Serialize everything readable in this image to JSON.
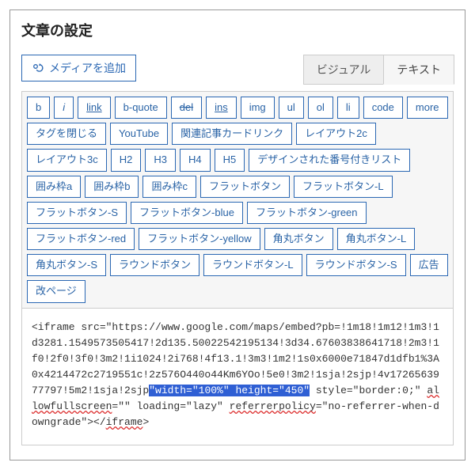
{
  "panel": {
    "title": "文章の設定"
  },
  "media_button": {
    "label": "メディアを追加"
  },
  "tabs": {
    "visual": "ビジュアル",
    "text": "テキスト",
    "active": "text"
  },
  "qt": {
    "b": "b",
    "i": "i",
    "link": "link",
    "bquote": "b-quote",
    "del": "del",
    "ins": "ins",
    "img": "img",
    "ul": "ul",
    "ol": "ol",
    "li": "li",
    "code": "code",
    "more": "more",
    "close": "タグを閉じる",
    "youtube": "YouTube",
    "relcard": "関連記事カードリンク",
    "layout2c": "レイアウト2c",
    "layout3c": "レイアウト3c",
    "h2": "H2",
    "h3": "H3",
    "h4": "H4",
    "h5": "H5",
    "designlist": "デザインされた番号付きリスト",
    "box_a": "囲み枠a",
    "box_b": "囲み枠b",
    "box_c": "囲み枠c",
    "flat": "フラットボタン",
    "flat_l": "フラットボタン-L",
    "flat_s": "フラットボタン-S",
    "flat_blue": "フラットボタン-blue",
    "flat_green": "フラットボタン-green",
    "flat_red": "フラットボタン-red",
    "flat_yellow": "フラットボタン-yellow",
    "round": "角丸ボタン",
    "round_l": "角丸ボタン-L",
    "round_s": "角丸ボタン-S",
    "rbtn": "ラウンドボタン",
    "rbtn_l": "ラウンドボタン-L",
    "rbtn_s": "ラウンドボタン-S",
    "ad": "広告",
    "pagebreak": "改ページ"
  },
  "editor": {
    "pre1": "<iframe src=\"https://www.google.com/maps/embed?pb=!1m18!1m12!1m3!1d3281.1549573505417!2d135.50022542195134!3d34.67603838641718!2m3!1f0!2f0!3f0!3m2!1i1024!2i768!4f13.1!3m3!1m2!1s0x6000e71847d1dfb1%3A0x4214472c2719551c!2z576O440o44Km6YOo!5e0!3m2!1sja!2sjp!4v1726563977797!5m2!1sja!2sjp",
    "highlight": "\"width=\"100%\" height=\"450\"",
    "mid1": " style=\"border:0;\" ",
    "sp_allow": "allowfullscreen",
    "mid2": "=\"\" loading=\"lazy\" ",
    "sp_ref": "referrerpolicy",
    "mid3": "=\"no-referrer-when-downgrade\"></",
    "sp_iframe": "iframe",
    "post1": ">"
  }
}
